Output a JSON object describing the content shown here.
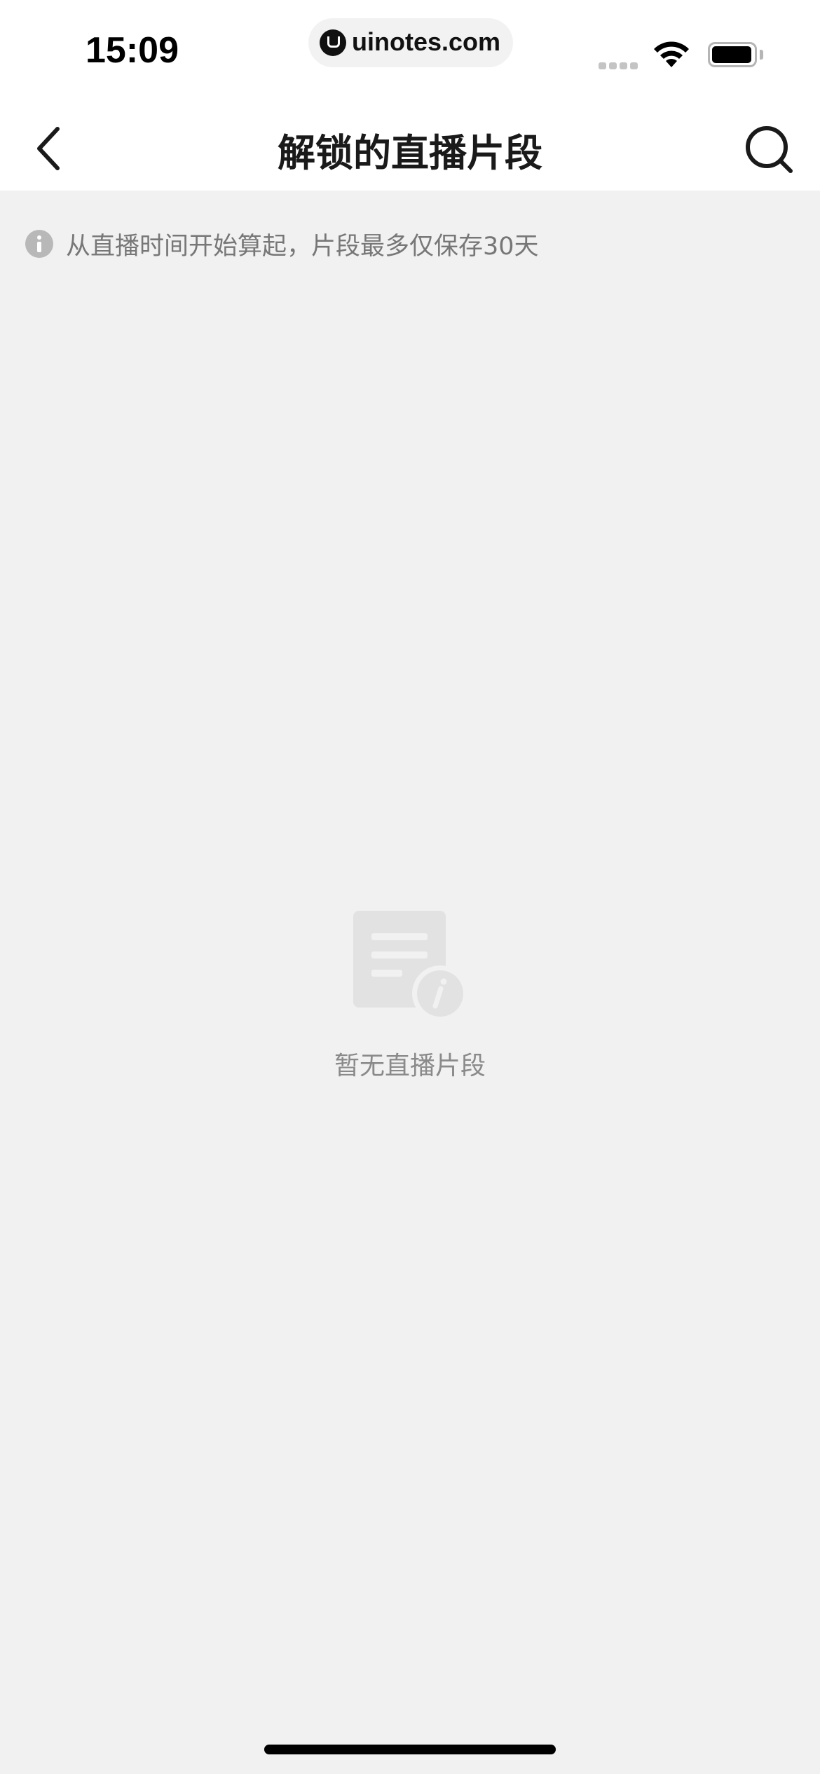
{
  "status_bar": {
    "time": "15:09",
    "url": "uinotes.com",
    "icons": [
      "signal-icon",
      "wifi-icon",
      "battery-icon"
    ]
  },
  "nav": {
    "title": "解锁的直播片段",
    "back_icon": "chevron-left-icon",
    "search_icon": "search-icon"
  },
  "notice": {
    "icon": "info-icon",
    "text": "从直播时间开始算起，片段最多仅保存30天"
  },
  "empty_state": {
    "icon": "document-info-icon",
    "text": "暂无直播片段"
  },
  "colors": {
    "page_background": "#f1f1f1",
    "bar_background": "#ffffff",
    "title_text": "#1a1a1a",
    "secondary_text": "#777777",
    "empty_icon": "#e2e2e2"
  }
}
